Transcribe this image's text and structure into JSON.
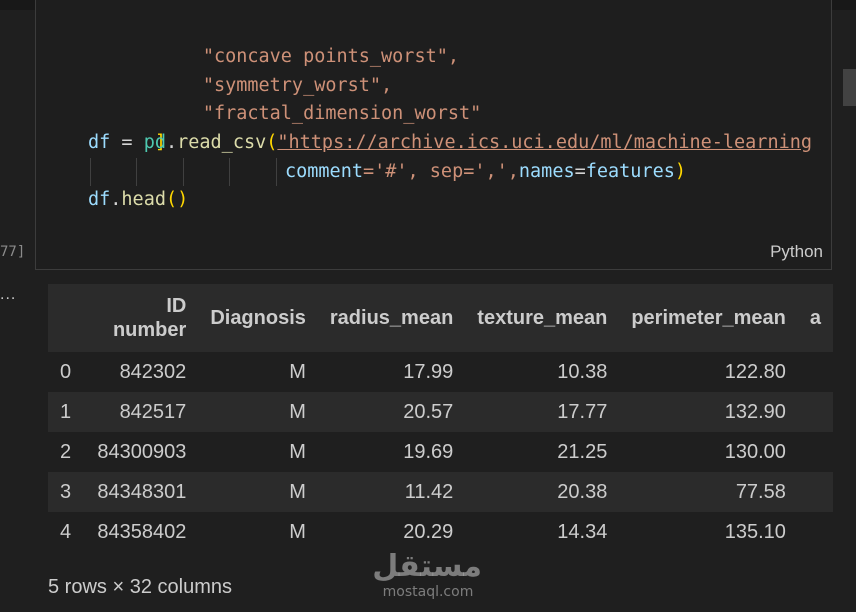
{
  "cell": {
    "code_lines": [
      "\"concave points_worst\",",
      "\"symmetry_worst\",",
      "\"fractal_dimension_worst\"",
      "]",
      "df",
      "=",
      "pd",
      ".",
      "read_csv",
      "(",
      "\"https://archive.ics.uci.edu/ml/machine-learning",
      "comment",
      "='#', sep=',',",
      "names",
      "=",
      "features",
      ")",
      "df",
      ".",
      "head",
      "()"
    ],
    "language": "Python",
    "execution_count": "77]"
  },
  "output": {
    "ellipsis": "...",
    "columns": [
      "",
      "ID number",
      "Diagnosis",
      "radius_mean",
      "texture_mean",
      "perimeter_mean",
      "a"
    ],
    "rows": [
      [
        "0",
        "842302",
        "M",
        "17.99",
        "10.38",
        "122.80",
        ""
      ],
      [
        "1",
        "842517",
        "M",
        "20.57",
        "17.77",
        "132.90",
        ""
      ],
      [
        "2",
        "84300903",
        "M",
        "19.69",
        "21.25",
        "130.00",
        ""
      ],
      [
        "3",
        "84348301",
        "M",
        "11.42",
        "20.38",
        "77.58",
        ""
      ],
      [
        "4",
        "84358402",
        "M",
        "20.29",
        "14.34",
        "135.10",
        ""
      ]
    ],
    "summary": "5 rows × 32 columns"
  },
  "watermark": {
    "arabic": "مستقل",
    "latin": "mostaql.com"
  }
}
